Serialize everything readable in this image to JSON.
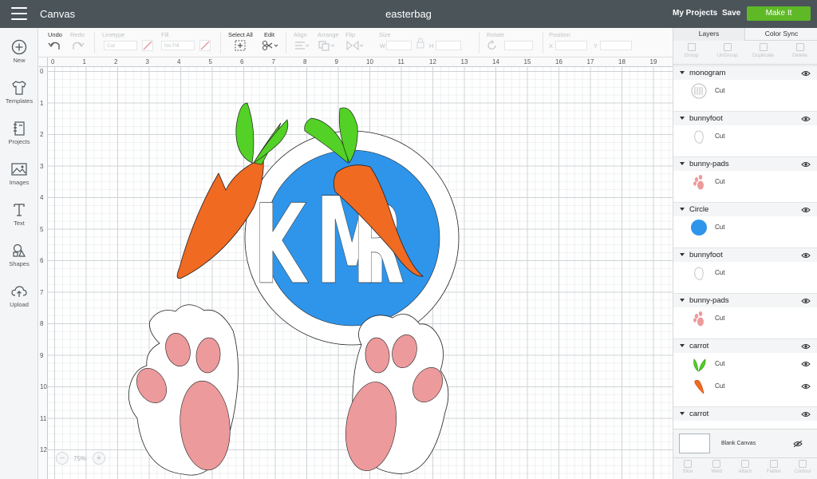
{
  "topbar": {
    "app_title": "Canvas",
    "doc_title": "easterbag",
    "my_projects": "My Projects",
    "save": "Save",
    "make_it": "Make It"
  },
  "sidebar": {
    "items": [
      {
        "label": "New",
        "icon": "plus-circle-icon"
      },
      {
        "label": "Templates",
        "icon": "shirt-icon"
      },
      {
        "label": "Projects",
        "icon": "notebook-icon"
      },
      {
        "label": "Images",
        "icon": "image-icon"
      },
      {
        "label": "Text",
        "icon": "text-t-icon"
      },
      {
        "label": "Shapes",
        "icon": "shapes-icon"
      },
      {
        "label": "Upload",
        "icon": "cloud-upload-icon"
      }
    ]
  },
  "toolbar": {
    "undo": "Undo",
    "redo": "Redo",
    "linetype": "Linetype",
    "linetype_value": "Cut",
    "fill": "Fill",
    "fill_value": "No Fill",
    "select_all": "Select All",
    "edit": "Edit",
    "align": "Align",
    "arrange": "Arrange",
    "flip": "Flip",
    "size": "Size",
    "size_w": "W",
    "size_h": "H",
    "rotate": "Rotate",
    "position": "Position",
    "pos_x": "X",
    "pos_y": "Y"
  },
  "rulers": {
    "top": [
      "0",
      "1",
      "2",
      "3",
      "4",
      "5",
      "6",
      "7",
      "8",
      "9",
      "10",
      "11",
      "12",
      "13",
      "14",
      "15",
      "16",
      "17",
      "18",
      "19"
    ],
    "left": [
      "0",
      "1",
      "2",
      "3",
      "4",
      "5",
      "6",
      "7",
      "8",
      "9",
      "10",
      "11",
      "12"
    ]
  },
  "canvas": {
    "monogram": [
      "K",
      "M",
      "R"
    ],
    "zoom": "75%"
  },
  "panel": {
    "tabs": {
      "layers": "Layers",
      "color_sync": "Color Sync"
    },
    "actions": [
      "Group",
      "UnGroup",
      "Duplicate",
      "Delete"
    ],
    "groups": [
      {
        "name": "monogram",
        "layers": [
          {
            "label": "Cut",
            "thumb": "monogram"
          }
        ]
      },
      {
        "name": "bunnyfoot",
        "layers": [
          {
            "label": "Cut",
            "thumb": "foot"
          }
        ]
      },
      {
        "name": "bunny-pads",
        "layers": [
          {
            "label": "Cut",
            "thumb": "pads"
          }
        ]
      },
      {
        "name": "Circle",
        "layers": [
          {
            "label": "Cut",
            "thumb": "circle"
          }
        ]
      },
      {
        "name": "bunnyfoot",
        "layers": [
          {
            "label": "Cut",
            "thumb": "foot"
          }
        ]
      },
      {
        "name": "bunny-pads",
        "layers": [
          {
            "label": "Cut",
            "thumb": "pads"
          }
        ]
      },
      {
        "name": "carrot",
        "layers": [
          {
            "label": "Cut",
            "thumb": "leaves"
          },
          {
            "label": "Cut",
            "thumb": "carrot"
          }
        ]
      },
      {
        "name": "carrot",
        "layers": []
      }
    ],
    "blank_canvas": "Blank Canvas",
    "bottom_actions": [
      "Slice",
      "Weld",
      "Attach",
      "Flatten",
      "Contour"
    ]
  },
  "colors": {
    "topbar": "#4a5459",
    "make_it": "#5fb927",
    "circle_blue": "#2f95ea",
    "carrot_orange": "#f06a22",
    "leaf_green": "#53d126",
    "pad_pink": "#ed9a9c"
  }
}
